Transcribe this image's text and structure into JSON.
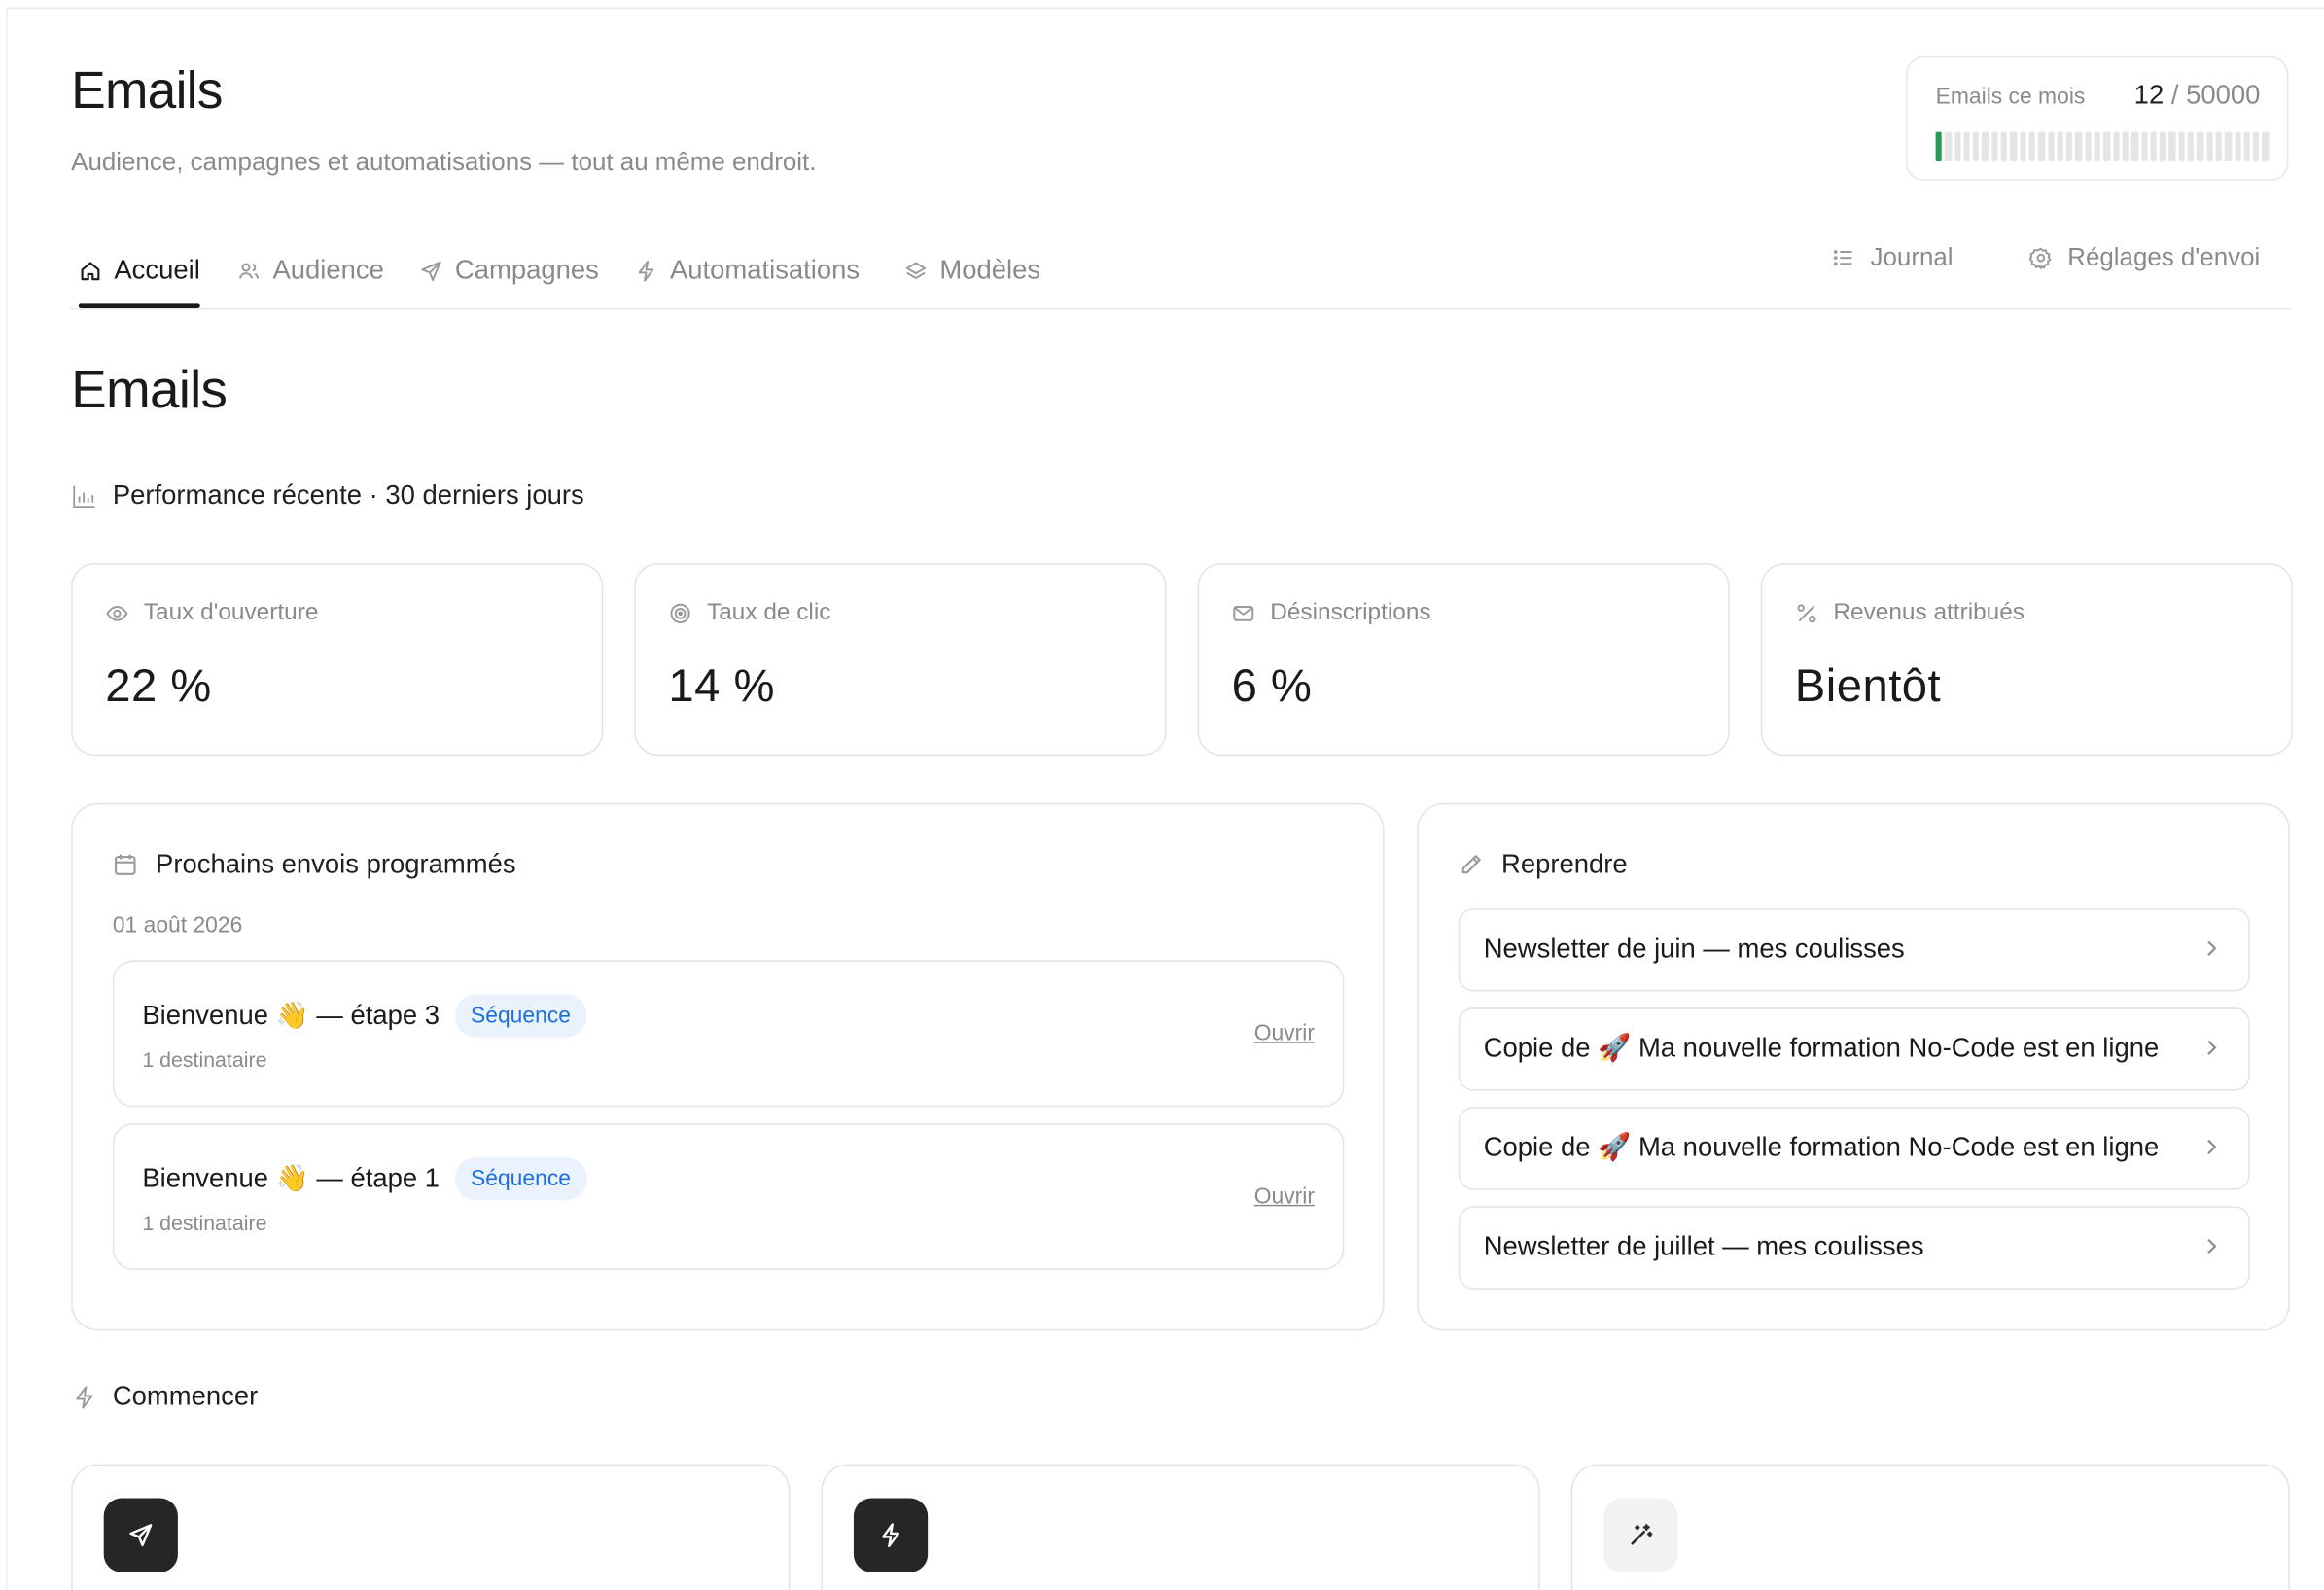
{
  "header": {
    "title": "Emails",
    "subtitle": "Audience, campagnes et automatisations — tout au même endroit."
  },
  "quota": {
    "label": "Emails ce mois",
    "used": "12",
    "total": "/ 50000",
    "fill_fraction": 0.00024
  },
  "tabs": {
    "items": [
      {
        "label": "Accueil",
        "icon": "home-icon",
        "active": true
      },
      {
        "label": "Audience",
        "icon": "users-icon",
        "active": false
      },
      {
        "label": "Campagnes",
        "icon": "send-icon",
        "active": false
      },
      {
        "label": "Automatisations",
        "icon": "bolt-icon",
        "active": false
      },
      {
        "label": "Modèles",
        "icon": "layers-icon",
        "active": false
      }
    ],
    "right": [
      {
        "label": "Journal",
        "icon": "list-icon"
      },
      {
        "label": "Réglages d'envoi",
        "icon": "gear-icon"
      }
    ]
  },
  "main": {
    "title": "Emails",
    "performance_heading": "Performance récente · 30 derniers jours",
    "kpis": [
      {
        "label": "Taux d'ouverture",
        "value": "22 %",
        "icon": "eye-icon"
      },
      {
        "label": "Taux de clic",
        "value": "14 %",
        "icon": "target-icon"
      },
      {
        "label": "Désinscriptions",
        "value": "6 %",
        "icon": "mail-icon"
      },
      {
        "label": "Revenus attribués",
        "value": "Bientôt",
        "icon": "percent-icon"
      }
    ],
    "scheduled": {
      "heading": "Prochains envois programmés",
      "date": "01 août 2026",
      "items": [
        {
          "title": "Bienvenue 👋 — étape 3",
          "badge": "Séquence",
          "recipients": "1 destinataire",
          "action": "Ouvrir"
        },
        {
          "title": "Bienvenue 👋 — étape 1",
          "badge": "Séquence",
          "recipients": "1 destinataire",
          "action": "Ouvrir"
        }
      ]
    },
    "resume": {
      "heading": "Reprendre",
      "items": [
        {
          "title": "Newsletter de juin — mes coulisses"
        },
        {
          "title": "Copie de 🚀 Ma nouvelle formation No-Code est en ligne"
        },
        {
          "title": "Copie de 🚀 Ma nouvelle formation No-Code est en ligne"
        },
        {
          "title": "Newsletter de juillet — mes coulisses"
        }
      ]
    },
    "start": {
      "heading": "Commencer",
      "cards": [
        {
          "icon": "send-icon"
        },
        {
          "icon": "bolt-icon"
        },
        {
          "icon": "magic-wand-icon"
        }
      ]
    }
  },
  "colors": {
    "accent_green": "#1f9d55",
    "badge_blue": "#1d6fe0",
    "badge_bg": "#eaf2fe",
    "text_muted": "#8a8a8a"
  }
}
